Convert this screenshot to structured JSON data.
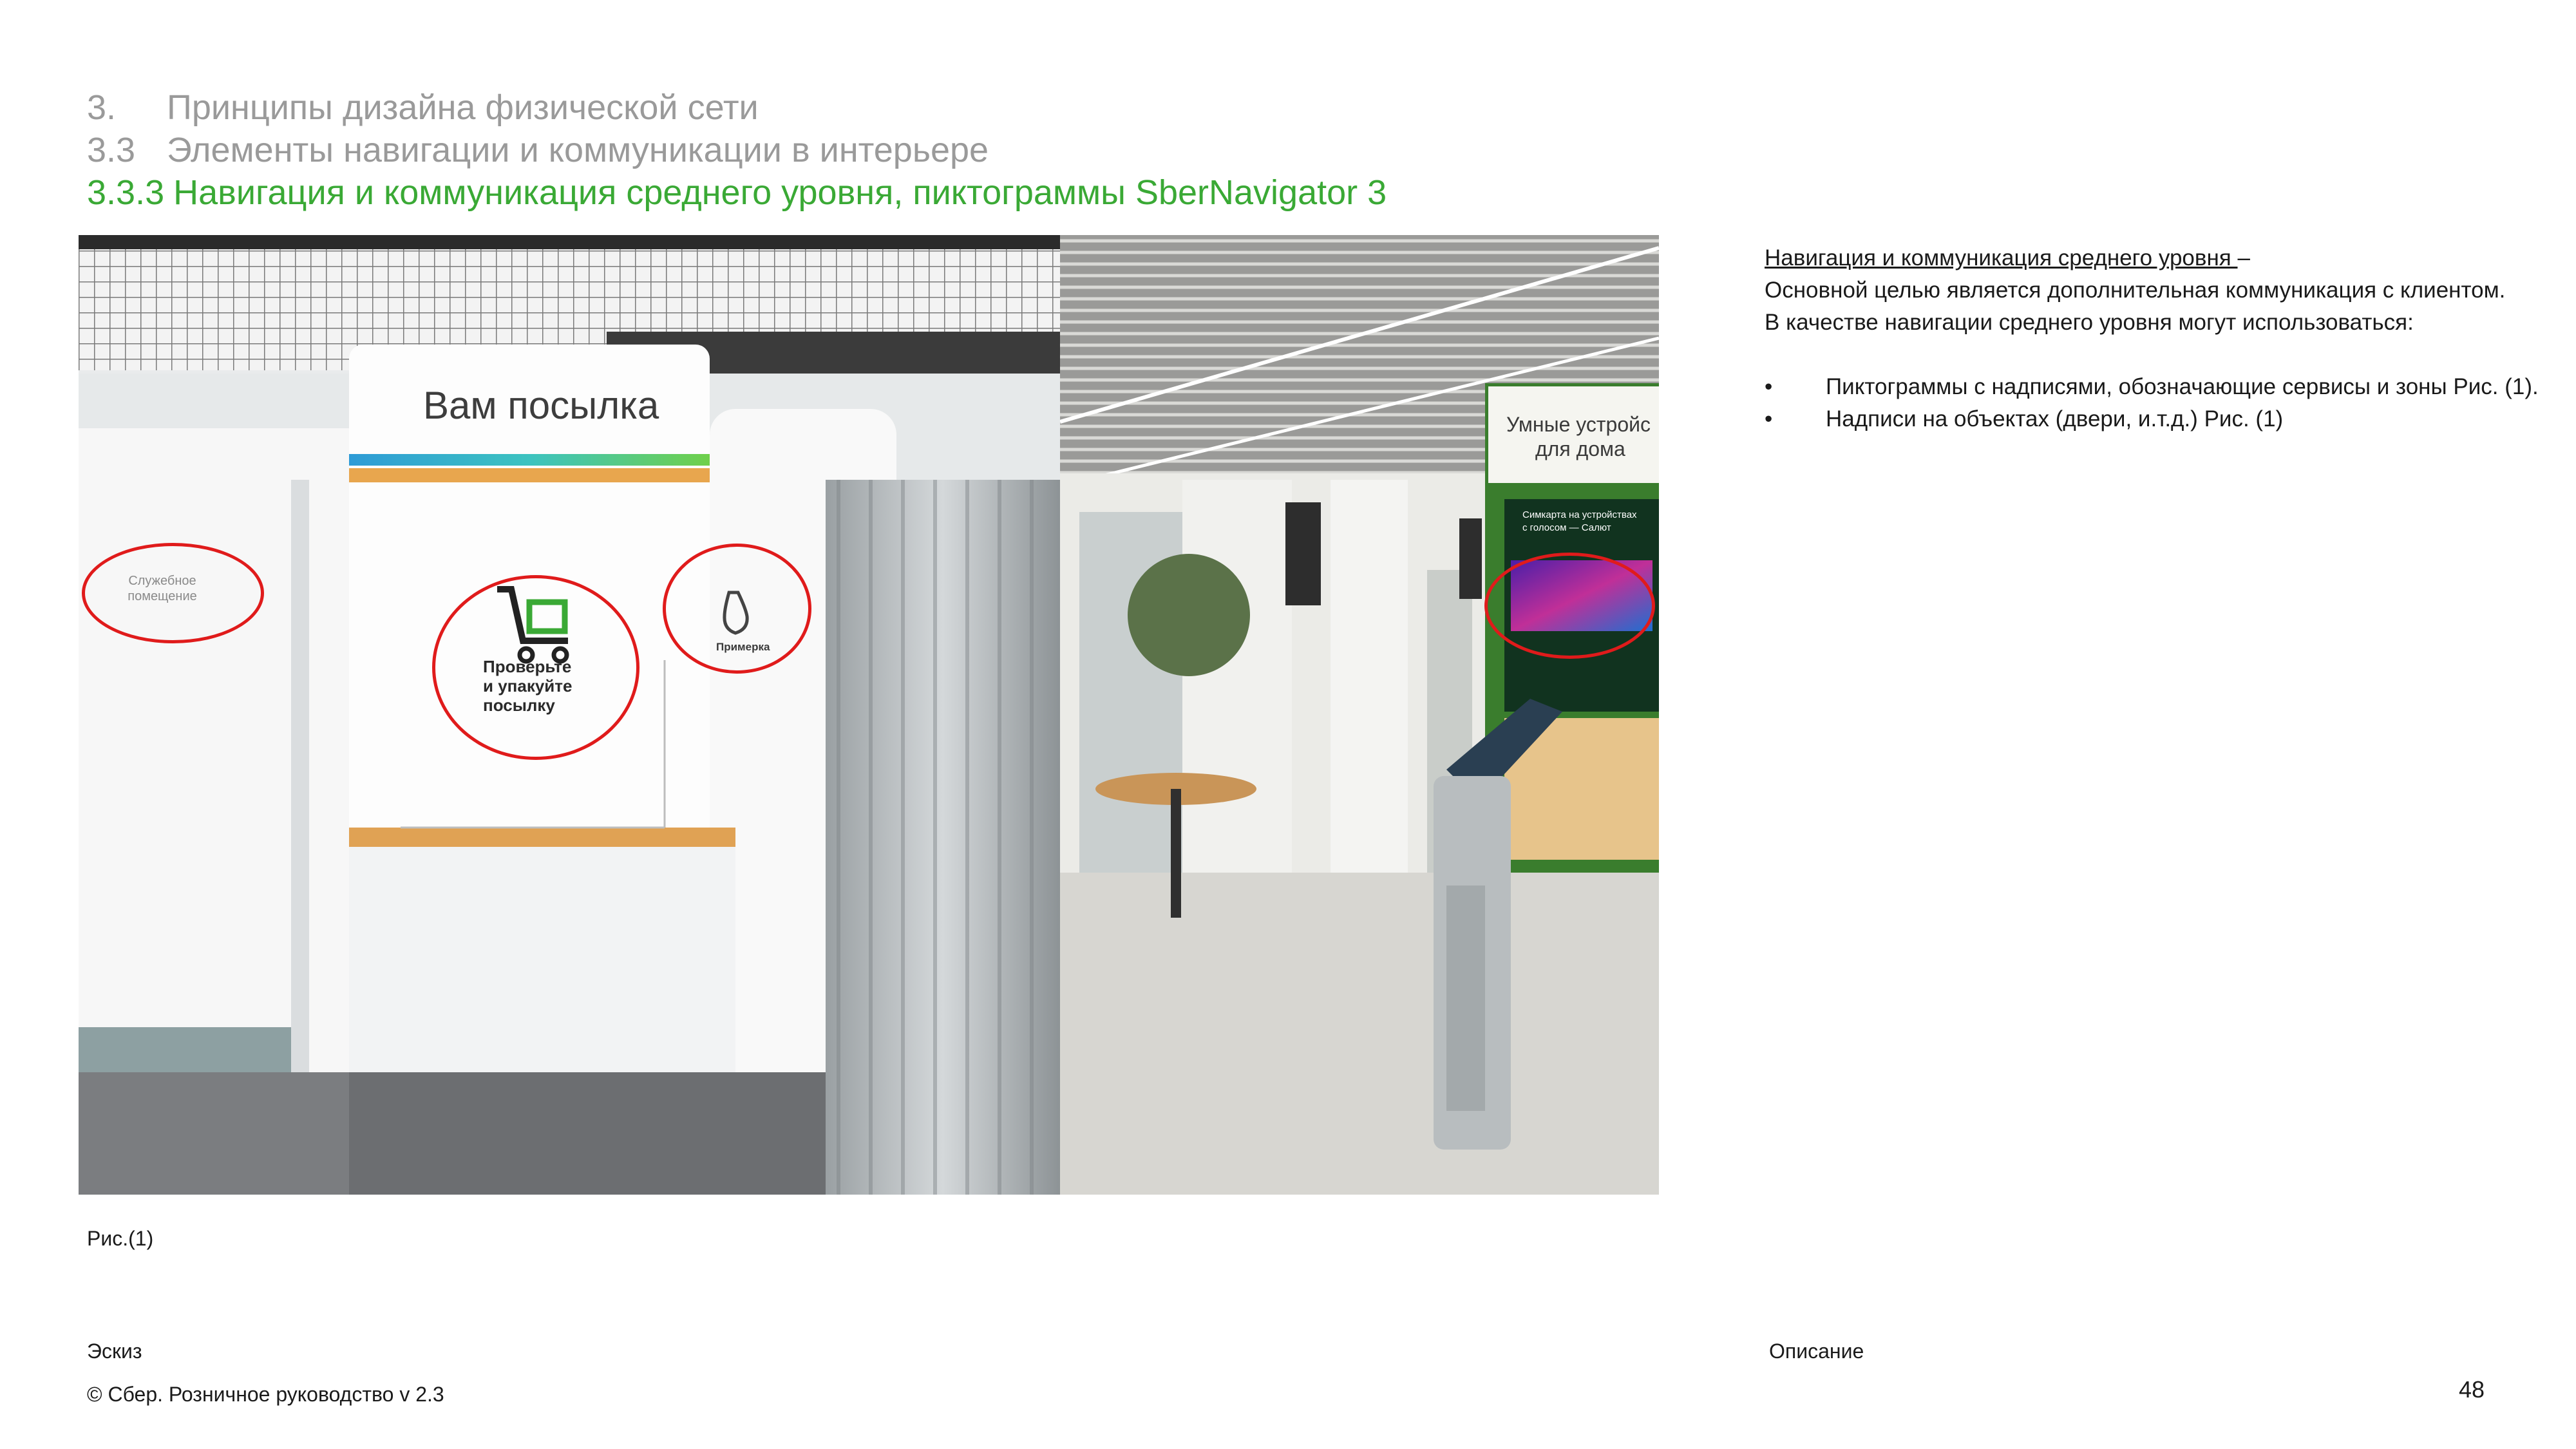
{
  "header": {
    "line1": {
      "num": "3.",
      "text": "Принципы дизайна физической сети"
    },
    "line2": {
      "num": "3.3",
      "text": "Элементы навигации и коммуникации в интерьере"
    },
    "line3": {
      "num": "3.3.3",
      "text": "Навигация и коммуникация среднего уровня, пиктограммы SberNavigator 3"
    }
  },
  "figure": {
    "caption": "Рис.(1)",
    "left_photo": {
      "sign_title": "Вам посылка",
      "door_label_line1": "Служебное",
      "door_label_line2": "помещение",
      "pictogram_text_line1": "Проверьте",
      "pictogram_text_line2": "и упакуйте",
      "pictogram_text_line3": "посылку",
      "fitting_label": "Примерка"
    },
    "right_photo": {
      "sign_line1": "Умные устройс",
      "sign_line2": "для дома",
      "screen_line1": "Симкарта на устройствах",
      "screen_line2": "с голосом — Салют"
    }
  },
  "description": {
    "term": "Навигация и коммуникация среднего уровня ",
    "dash": "–",
    "line_goal": "Основной целью является  дополнительная коммуникация с клиентом.",
    "line_usage": "В качестве навигации среднего уровня могут использоваться:",
    "bullets": [
      {
        "symbol": "•",
        "text": "Пиктограммы с надписями, обозначающие сервисы и зоны Рис. (1)."
      },
      {
        "symbol": "•",
        "text": "Надписи на объектах (двери, и.т.д.) Рис. (1)"
      }
    ]
  },
  "footer": {
    "left_label": "Эскиз",
    "right_label": "Описание",
    "copyright": "© Сбер. Розничное руководство  v 2.3",
    "page_number": "48"
  },
  "colors": {
    "accent_green": "#3aa935",
    "heading_grey": "#9a9a9a",
    "annotation_red": "#e01b1b"
  }
}
